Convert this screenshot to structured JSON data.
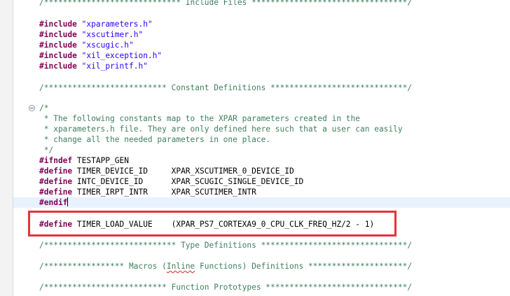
{
  "editor": {
    "lines": {
      "hdr_include": "/***************************** Include Files *********************************/",
      "inc1_kw": "#include",
      "inc1_file": "\"xparameters.h\"",
      "inc2_kw": "#include",
      "inc2_file": "\"xscutimer.h\"",
      "inc3_kw": "#include",
      "inc3_file": "\"xscugic.h\"",
      "inc4_kw": "#include",
      "inc4_file": "\"xil_exception.h\"",
      "inc5_kw": "#include",
      "inc5_file": "\"xil_printf.h\"",
      "hdr_const": "/************************** Constant Definitions *****************************/",
      "c1": "/*",
      "c2": " * The following constants map to the XPAR parameters created in the",
      "c3": " * xparameters.h file. They are only defined here such that a user can easily",
      "c4": " * change all the needed parameters in one place.",
      "c5": " */",
      "ifndef_kw": "#ifndef",
      "ifndef_rest": " TESTAPP_GEN",
      "d1_kw": "#define",
      "d1_rest": " TIMER_DEVICE_ID     XPAR_XSCUTIMER_0_DEVICE_ID",
      "d2_kw": "#define",
      "d2_rest": " INTC_DEVICE_ID      XPAR_SCUGIC_SINGLE_DEVICE_ID",
      "d3_kw": "#define",
      "d3_rest": " TIMER_IRPT_INTR     XPAR_SCUTIMER_INTR",
      "endif_kw": "#endif",
      "d4_kw": "#define",
      "d4_rest": " TIMER_LOAD_VALUE    (XPAR_PS7_CORTEXA9_0_CPU_CLK_FREQ_HZ/2 - 1)",
      "hdr_type": "/**************************** Type Definitions *******************************/",
      "hdr_macros_a": "/***************** Macros (",
      "hdr_macros_inline": "Inline",
      "hdr_macros_b": " Functions) Definitions *********************/",
      "hdr_proto": "/************************** Function Prototypes ******************************/"
    }
  }
}
